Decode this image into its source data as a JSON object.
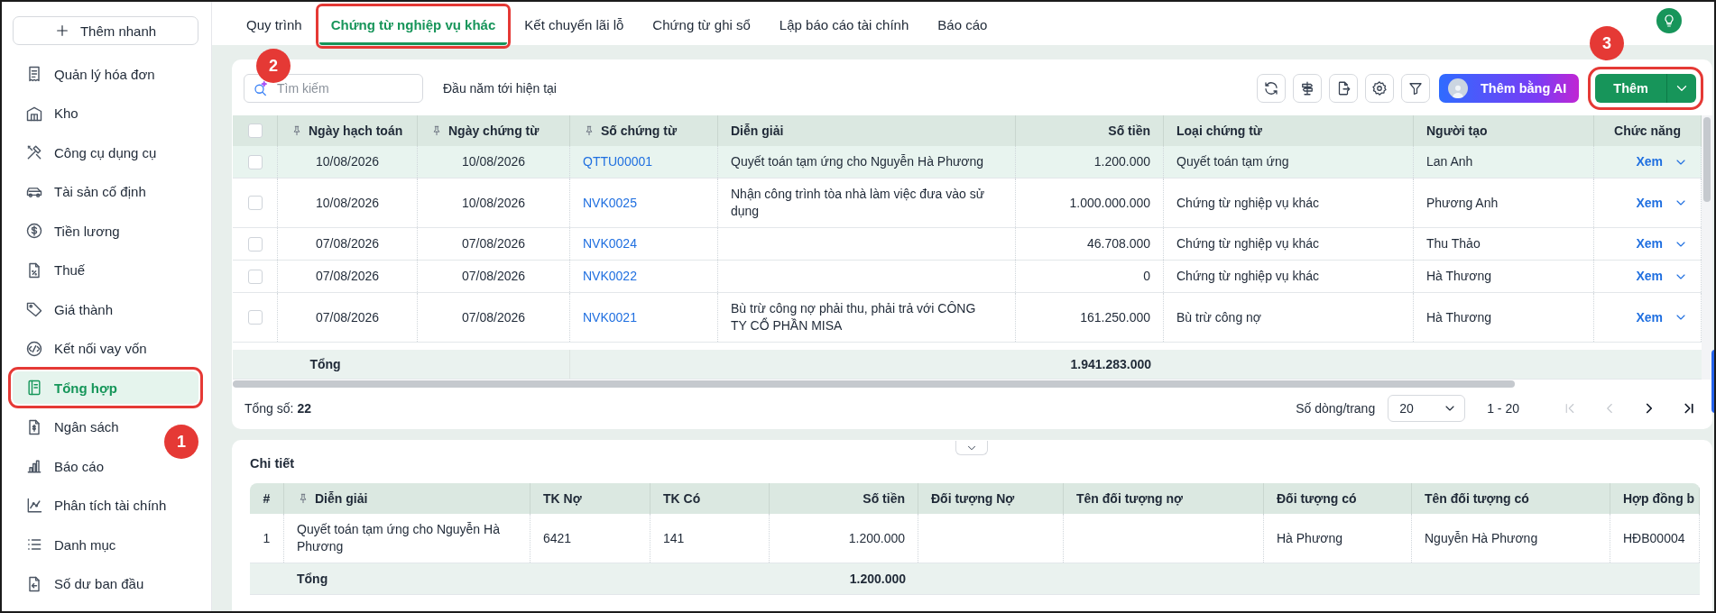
{
  "sidebar": {
    "quick_add": {
      "label": "Thêm nhanh"
    },
    "items": [
      {
        "label": "Quản lý hóa đơn",
        "selected": false,
        "highlighted": false
      },
      {
        "label": "Kho",
        "selected": false,
        "highlighted": false
      },
      {
        "label": "Công cụ dụng cụ",
        "selected": false,
        "highlighted": false
      },
      {
        "label": "Tài sản cố định",
        "selected": false,
        "highlighted": false
      },
      {
        "label": "Tiền lương",
        "selected": false,
        "highlighted": false
      },
      {
        "label": "Thuế",
        "selected": false,
        "highlighted": false
      },
      {
        "label": "Giá thành",
        "selected": false,
        "highlighted": false
      },
      {
        "label": "Kết nối vay vốn",
        "selected": false,
        "highlighted": false
      },
      {
        "label": "Tổng hợp",
        "selected": true,
        "highlighted": true
      },
      {
        "label": "Ngân sách",
        "selected": false,
        "highlighted": false
      },
      {
        "label": "Báo cáo",
        "selected": false,
        "highlighted": false
      },
      {
        "label": "Phân tích tài chính",
        "selected": false,
        "highlighted": false
      },
      {
        "label": "Danh mục",
        "selected": false,
        "highlighted": false
      },
      {
        "label": "Số dư ban đầu",
        "selected": false,
        "highlighted": false
      }
    ]
  },
  "tabs": [
    {
      "label": "Quy trình",
      "selected": false,
      "highlighted": false
    },
    {
      "label": "Chứng từ nghiệp vụ khác",
      "selected": true,
      "highlighted": true
    },
    {
      "label": "Kết chuyển lãi lỗ",
      "selected": false,
      "highlighted": false
    },
    {
      "label": "Chứng từ ghi sổ",
      "selected": false,
      "highlighted": false
    },
    {
      "label": "Lập báo cáo tài chính",
      "selected": false,
      "highlighted": false
    },
    {
      "label": "Báo cáo",
      "selected": false,
      "highlighted": false
    }
  ],
  "toolbar": {
    "search": {
      "placeholder": "Tìm kiếm"
    },
    "period": "Đầu năm tới hiện tại",
    "ai_button": "Thêm bằng AI",
    "add_button": {
      "label": "Thêm",
      "highlighted": true
    }
  },
  "table": {
    "header_checked": false,
    "columns": [
      {
        "kind": "check",
        "pinned": false
      },
      {
        "label": "Ngày hạch toán",
        "kind": "date",
        "pinned": true
      },
      {
        "label": "Ngày chứng từ",
        "kind": "date",
        "pinned": true
      },
      {
        "label": "Số chứng từ",
        "kind": "link",
        "pinned": true
      },
      {
        "label": "Diễn giải",
        "kind": "text",
        "pinned": false
      },
      {
        "label": "Số tiền",
        "kind": "amount",
        "pinned": false
      },
      {
        "label": "Loại chứng từ",
        "kind": "text",
        "pinned": false
      },
      {
        "label": "Người tạo",
        "kind": "text",
        "pinned": false
      },
      {
        "label": "Chức năng",
        "kind": "action",
        "pinned": false
      }
    ],
    "rows": [
      {
        "checked": false,
        "selected": true,
        "cells": [
          null,
          "10/08/2026",
          "10/08/2026",
          "QTTU00001",
          "Quyết toán tạm ứng cho Nguyễn Hà Phương",
          "1.200.000",
          "Quyết toán tạm ứng",
          "Lan Anh",
          "Xem"
        ]
      },
      {
        "checked": false,
        "selected": false,
        "cells": [
          null,
          "10/08/2026",
          "10/08/2026",
          "NVK0025",
          "Nhận công trình tòa nhà làm việc đưa vào sử dụng",
          "1.000.000.000",
          "Chứng từ nghiệp vụ khác",
          "Phương Anh",
          "Xem"
        ]
      },
      {
        "checked": false,
        "selected": false,
        "cells": [
          null,
          "07/08/2026",
          "07/08/2026",
          "NVK0024",
          null,
          "46.708.000",
          "Chứng từ nghiệp vụ khác",
          "Thu Thảo",
          "Xem"
        ]
      },
      {
        "checked": false,
        "selected": false,
        "cells": [
          null,
          "07/08/2026",
          "07/08/2026",
          "NVK0022",
          null,
          "0",
          "Chứng từ nghiệp vụ khác",
          "Hà Thương",
          "Xem"
        ]
      },
      {
        "checked": false,
        "selected": false,
        "cells": [
          null,
          "07/08/2026",
          "07/08/2026",
          "NVK0021",
          "Bù trừ công nợ phải thu, phải trả với CÔNG TY CỔ PHẦN MISA",
          "161.250.000",
          "Bù trừ công nợ",
          "Hà Thương",
          "Xem"
        ]
      }
    ],
    "total": {
      "label": "Tổng",
      "amount": "1.941.283.000"
    }
  },
  "footer": {
    "count_label": "Tổng số:",
    "count": "22",
    "page_size_label": "Số dòng/trang",
    "page_size": "20",
    "range": "1 - 20",
    "nav": [
      {
        "kind": "first",
        "disabled": true
      },
      {
        "kind": "prev",
        "disabled": true
      },
      {
        "kind": "next",
        "disabled": false
      },
      {
        "kind": "last",
        "disabled": false
      }
    ]
  },
  "detail": {
    "title": "Chi tiết",
    "columns": [
      {
        "label": "#",
        "kind": "index",
        "pinned": false
      },
      {
        "label": "Diễn giải",
        "kind": "text",
        "pinned": true
      },
      {
        "label": "TK Nợ",
        "kind": "text",
        "pinned": false
      },
      {
        "label": "TK Có",
        "kind": "text",
        "pinned": false
      },
      {
        "label": "Số tiền",
        "kind": "amount",
        "pinned": false
      },
      {
        "label": "Đối tượng Nợ",
        "kind": "text",
        "pinned": false
      },
      {
        "label": "Tên đối tượng nợ",
        "kind": "text",
        "pinned": false
      },
      {
        "label": "Đối tượng có",
        "kind": "text",
        "pinned": false
      },
      {
        "label": "Tên đối tượng có",
        "kind": "text",
        "pinned": false
      },
      {
        "label": "Hợp đồng b",
        "kind": "text",
        "pinned": false
      }
    ],
    "rows": [
      {
        "cells": [
          "1",
          "Quyết toán tạm ứng cho Nguyễn Hà Phương",
          "6421",
          "141",
          "1.200.000",
          null,
          null,
          "Hà Phương",
          "Nguyễn Hà Phương",
          "HĐB00004"
        ]
      }
    ],
    "total": {
      "label": "Tổng",
      "amount": "1.200.000"
    }
  },
  "annotations": [
    {
      "label": "1"
    },
    {
      "label": "2"
    },
    {
      "label": "3"
    }
  ]
}
